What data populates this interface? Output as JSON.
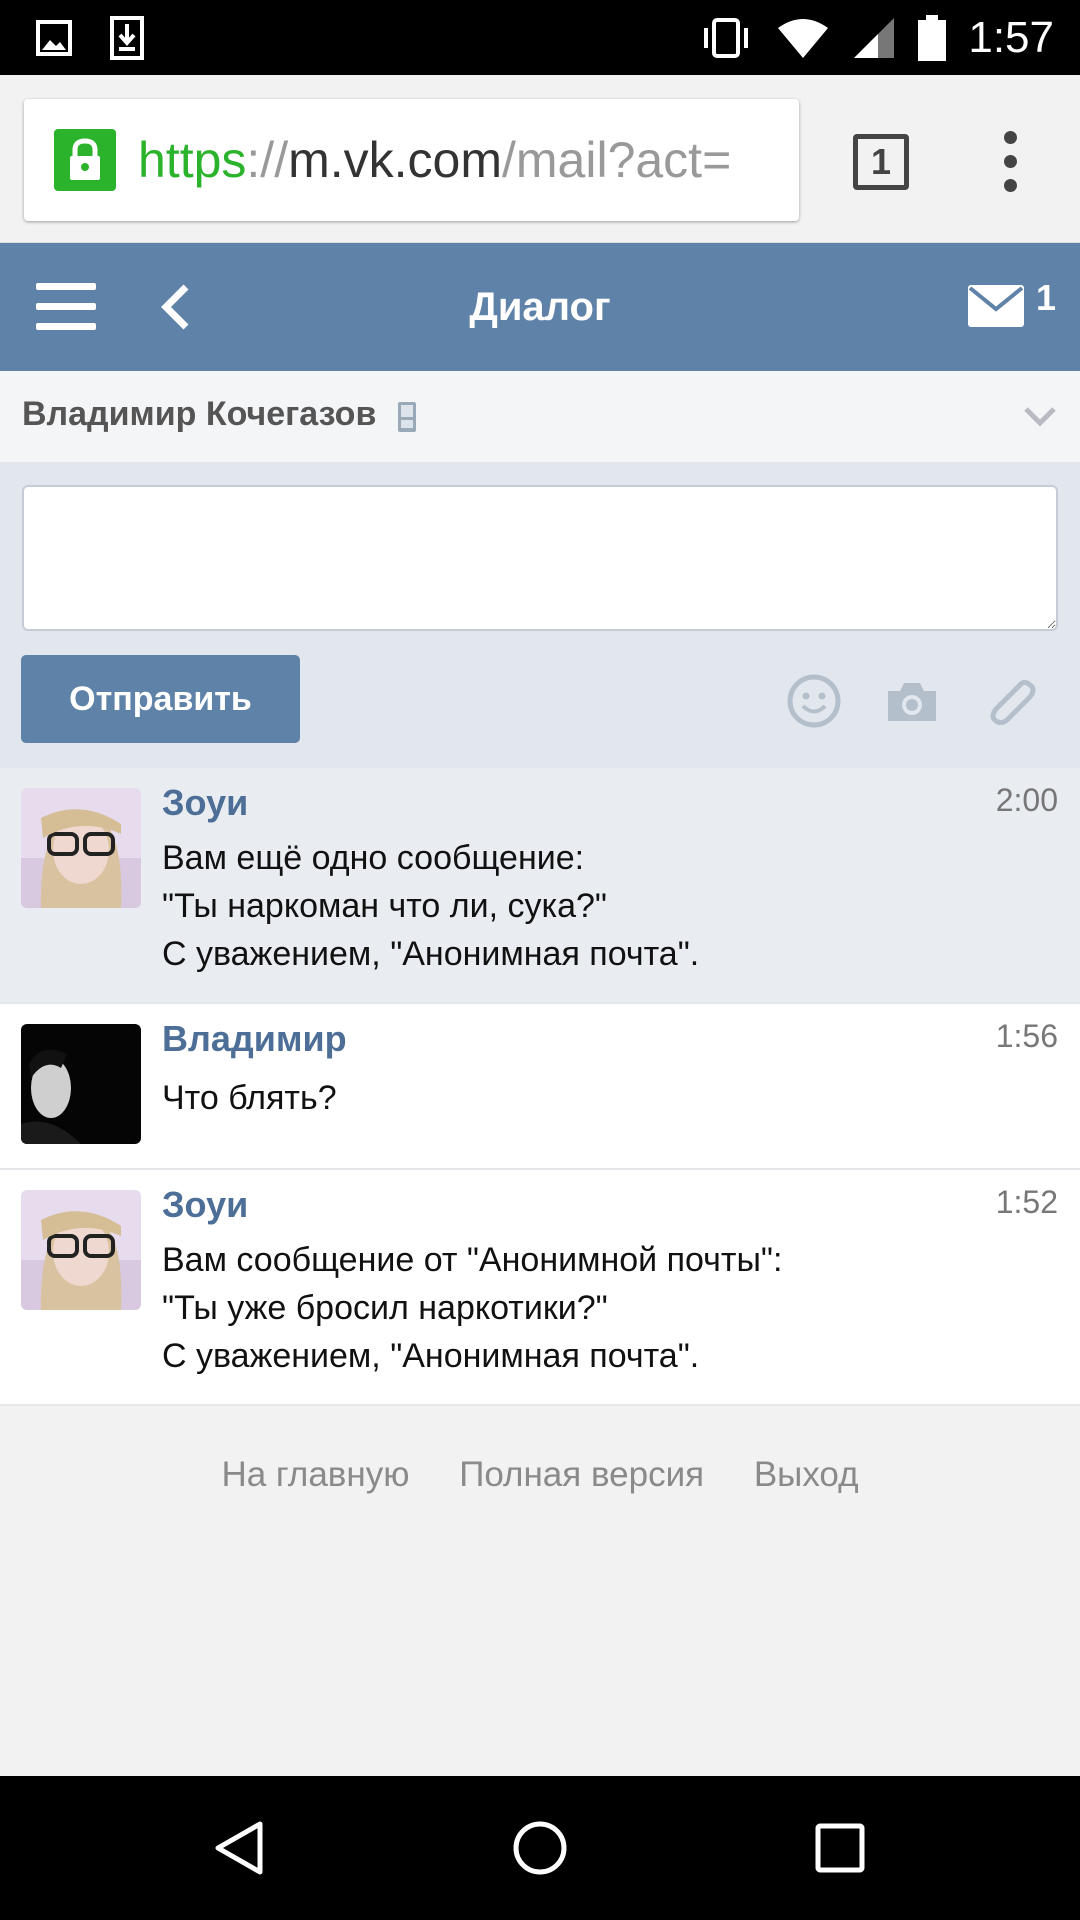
{
  "status_bar": {
    "time": "1:57",
    "left_icons": [
      "image-icon",
      "download-icon"
    ],
    "right_icons": [
      "vibrate-icon",
      "wifi-icon",
      "signal-icon",
      "battery-icon"
    ]
  },
  "browser": {
    "url_scheme": "https",
    "url_sep": "://",
    "url_host": "m.vk.com",
    "url_path": "/mail?act=",
    "tab_count": "1"
  },
  "header": {
    "title": "Диалог",
    "mail_count": "1"
  },
  "dialog": {
    "peer_name": "Владимир Кочегазов"
  },
  "composer": {
    "send_label": "Отправить",
    "placeholder": ""
  },
  "messages": [
    {
      "author": "Зоуи",
      "time": "2:00",
      "lines": [
        "Вам ещё одно сообщение:",
        "\"Ты наркоман что ли, сука?\"",
        "С уважением, \"Анонимная почта\"."
      ],
      "unread": true
    },
    {
      "author": "Владимир",
      "time": "1:56",
      "lines": [
        "Что блять?"
      ],
      "unread": false
    },
    {
      "author": "Зоуи",
      "time": "1:52",
      "lines": [
        "Вам сообщение от \"Анонимной почты\":",
        "\"Ты уже бросил наркотики?\"",
        "С уважением, \"Анонимная почта\"."
      ],
      "unread": false
    }
  ],
  "footer": {
    "links": [
      "На главную",
      "Полная версия",
      "Выход"
    ]
  },
  "colors": {
    "vk_blue": "#5f82a8",
    "author_blue": "#4d6e96",
    "secure_green": "#2bb32b"
  }
}
